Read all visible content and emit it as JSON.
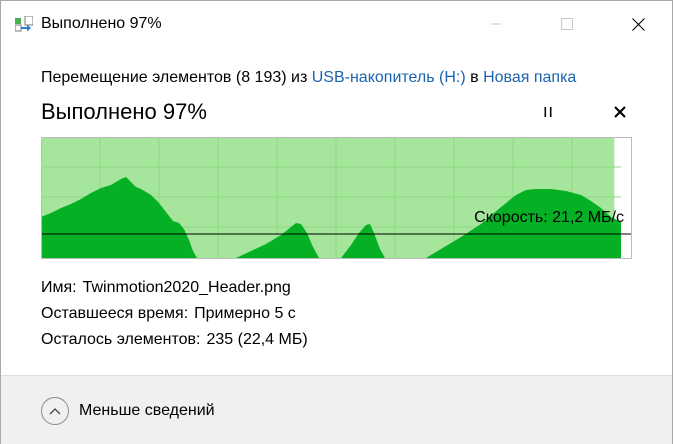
{
  "window": {
    "title": "Выполнено 97%",
    "icons": {
      "app": "file-move-icon",
      "minimize": "minimize-icon",
      "maximize": "maximize-icon",
      "close": "close-icon"
    }
  },
  "operation": {
    "prefix": "Перемещение элементов (8 193) из ",
    "source": "USB-накопитель (H:)",
    "middle": " в ",
    "destination": "Новая папка"
  },
  "status": {
    "heading": "Выполнено 97%",
    "progress_percent": 97,
    "pause_icon": "pause-icon",
    "cancel_icon": "cancel-icon"
  },
  "speed": {
    "label": "Скорость: 21,2 МБ/с"
  },
  "details": {
    "name_label": "Имя:",
    "name_value": "Twinmotion2020_Header.png",
    "time_label": "Оставшееся время:",
    "time_value": "Примерно 5 с",
    "items_label": "Осталось элементов:",
    "items_value": "235 (22,4 МБ)"
  },
  "footer": {
    "less_label": "Меньше сведений",
    "chevron_icon": "chevron-up-icon"
  },
  "colors": {
    "progress_fill": "#a6e59c",
    "speed_fill": "#06b025",
    "accent": "#1a64b0"
  }
}
